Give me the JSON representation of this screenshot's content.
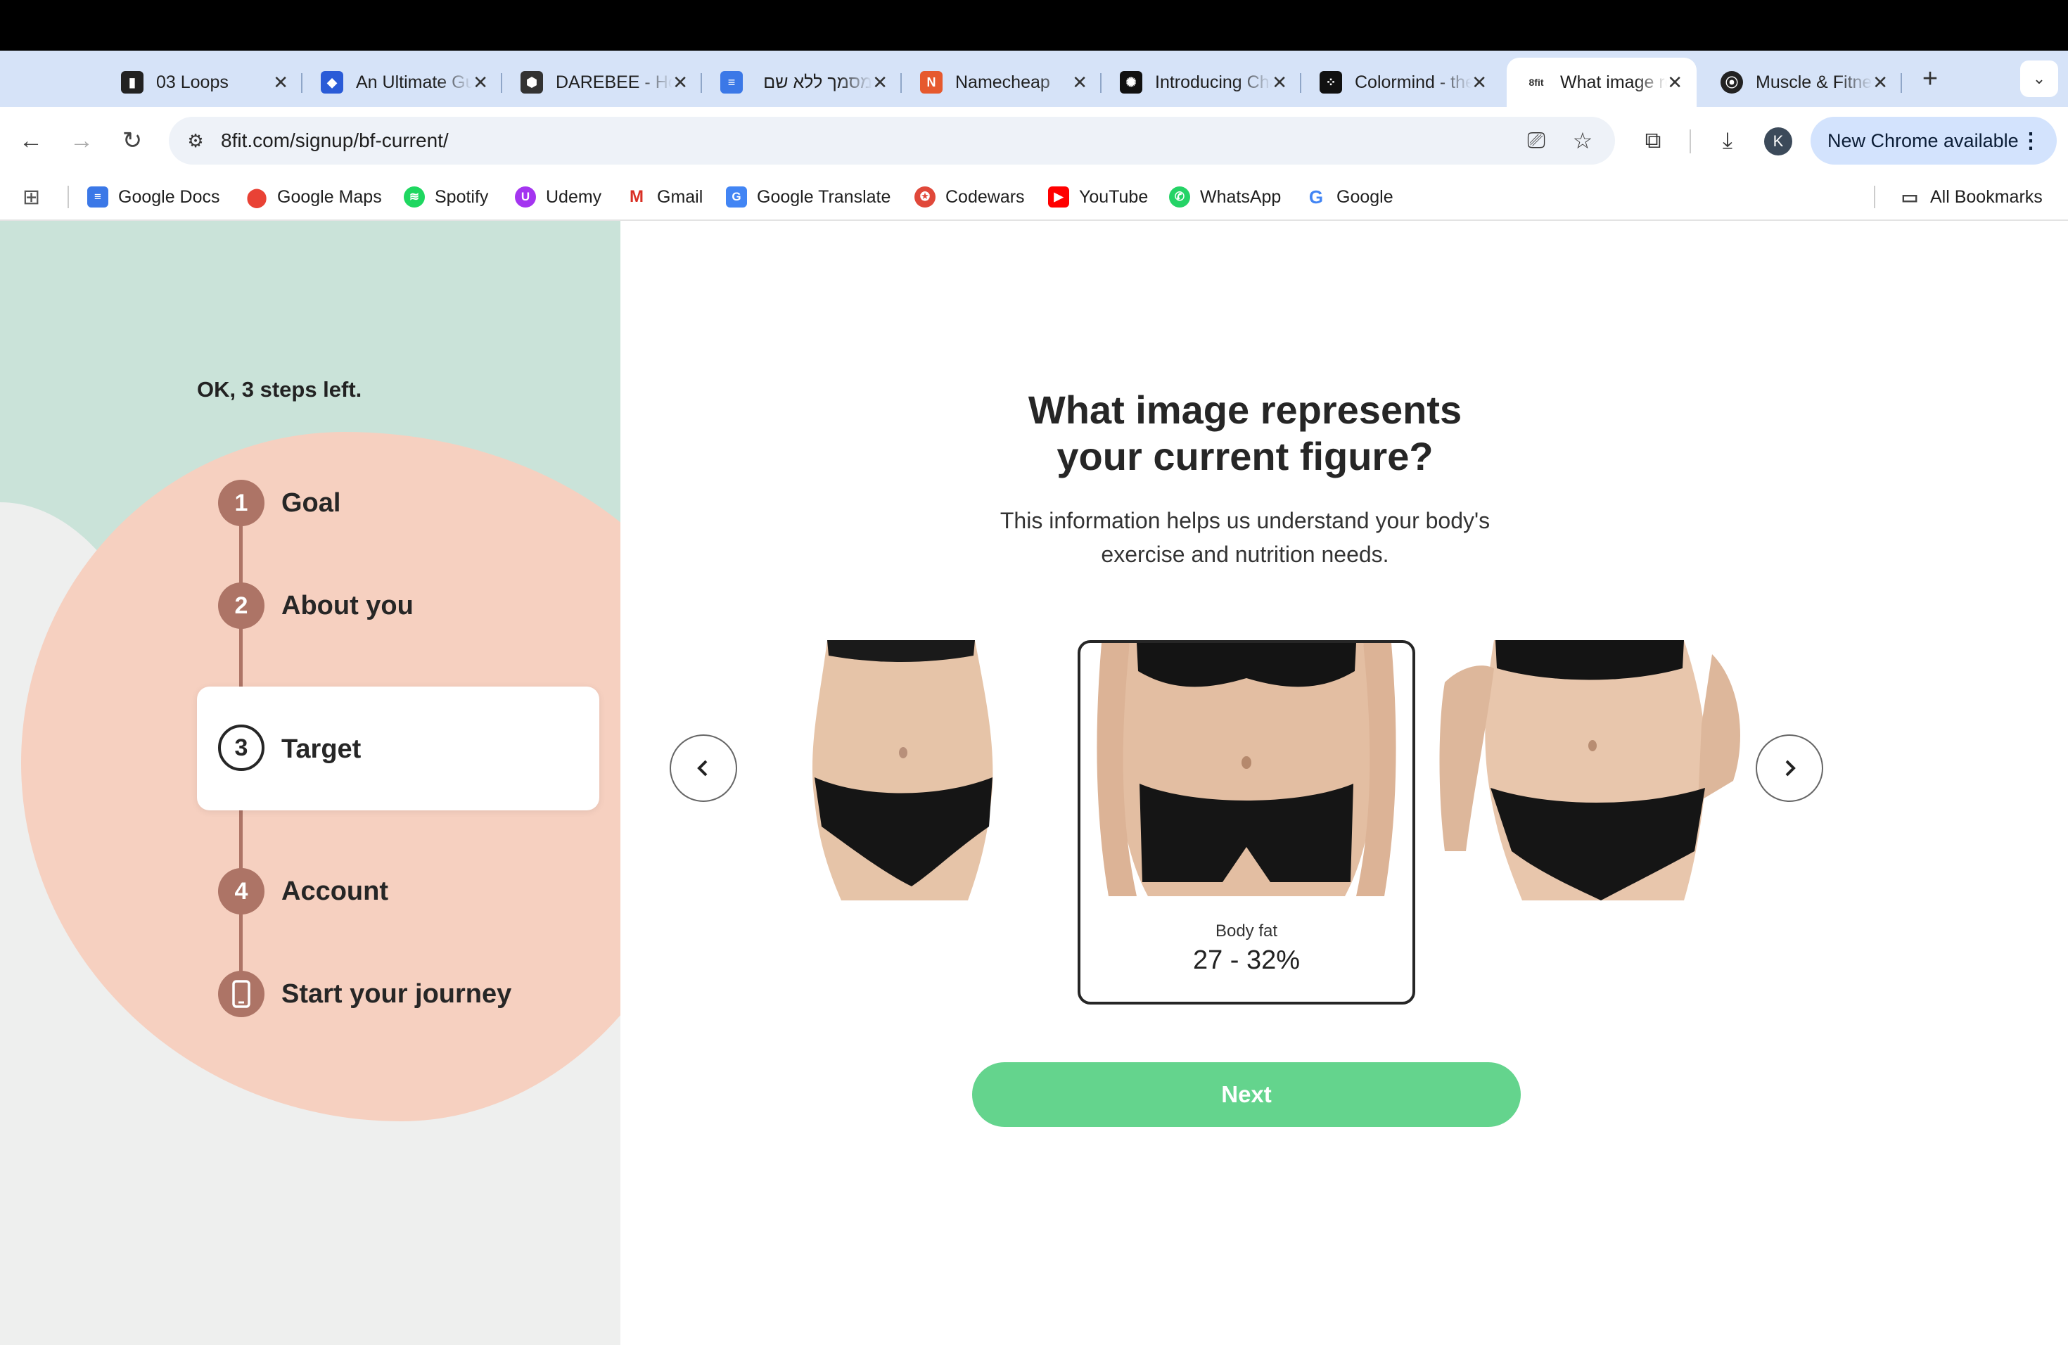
{
  "tabs": [
    {
      "title": "03 Loops",
      "icon": "tab-favicon-icon"
    },
    {
      "title": "An Ultimate Guide",
      "icon": "tab-favicon-icon"
    },
    {
      "title": "DAREBEE - Home",
      "icon": "darebee-icon"
    },
    {
      "title": "מסמך ללא שם",
      "icon": "docs-icon"
    },
    {
      "title": "Namecheap",
      "icon": "namecheap-icon"
    },
    {
      "title": "Introducing ChatGPT",
      "icon": "openai-icon"
    },
    {
      "title": "Colormind - the AI",
      "icon": "colormind-icon"
    },
    {
      "title": "What image represents",
      "icon": "8fit-icon",
      "active": true
    },
    {
      "title": "Muscle & Fitness",
      "icon": "dumbbell-icon"
    }
  ],
  "browser": {
    "url": "8fit.com/signup/bf-current/",
    "avatar_letter": "K",
    "update_label": "New Chrome available"
  },
  "bookmarks": [
    "Google Docs",
    "Google Maps",
    "Spotify",
    "Udemy",
    "Gmail",
    "Google Translate",
    "Codewars",
    "YouTube",
    "WhatsApp",
    "Google"
  ],
  "all_bookmarks_label": "All Bookmarks",
  "sidebar": {
    "steps_left": "OK, 3 steps left.",
    "steps": [
      {
        "number": "1",
        "label": "Goal"
      },
      {
        "number": "2",
        "label": "About you"
      },
      {
        "number": "3",
        "label": "Target"
      },
      {
        "number": "4",
        "label": "Account"
      },
      {
        "number": "",
        "label": "Start your journey"
      }
    ]
  },
  "main": {
    "question_line1": "What image represents",
    "question_line2": "your current figure?",
    "subtext_line1": "This information helps us understand your body's",
    "subtext_line2": "exercise and nutrition needs.",
    "selected_option": {
      "label": "Body fat",
      "value": "27 - 32%"
    },
    "next_label": "Next"
  },
  "colors": {
    "accent_green": "#64d48d",
    "step_brown": "#ad7466",
    "peach": "#f6d0c0",
    "mint": "#cae3d9"
  }
}
